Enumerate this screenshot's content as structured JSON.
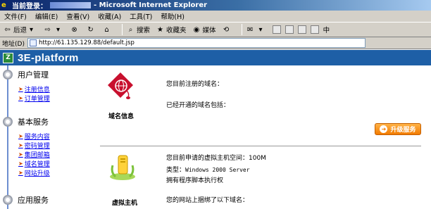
{
  "window": {
    "title_prefix": "当前登录：",
    "title_app": "- Microsoft Internet Explorer"
  },
  "menu": [
    "文件(F)",
    "编辑(E)",
    "查看(V)",
    "收藏(A)",
    "工具(T)",
    "帮助(H)"
  ],
  "toolbar": {
    "back": "后退",
    "search": "搜索",
    "favorites": "收藏夹",
    "media": "媒体",
    "extra": "中"
  },
  "address": {
    "label": "地址(D)",
    "url": "http://61.135.129.88/default.jsp"
  },
  "banner": {
    "brand": "3E-platform"
  },
  "sidebar": {
    "sections": [
      {
        "title": "用户管理",
        "items": [
          "注册信息",
          "订单管理"
        ]
      },
      {
        "title": "基本服务",
        "items": [
          "服务内容",
          "密码管理",
          "集团邮箱",
          "域名管理",
          "网站升级"
        ]
      },
      {
        "title": "应用服务",
        "items": []
      }
    ]
  },
  "main": {
    "domain_info_label": "域名信息",
    "registered_domain": "您目前注册的域名：",
    "opened_domains": "已经开通的域名包括：",
    "upgrade_button": "升级服务",
    "host_label": "虚拟主机",
    "host_space": "您目前申请的虚拟主机空间：100M",
    "type_label": "类型：",
    "type_value": "Windows 2000 Server",
    "script_perm": "拥有程序脚本执行权",
    "bound_domains": "您的网站上捆绑了以下域名："
  },
  "colors": {
    "banner": "#1e5fa6",
    "link": "#0000ee",
    "upgrade": "#f27b00"
  }
}
